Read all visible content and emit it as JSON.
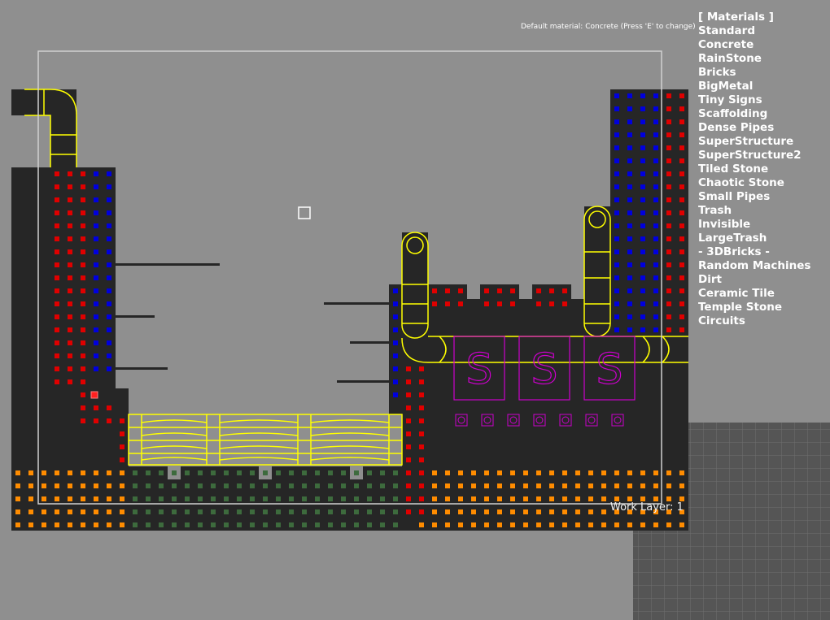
{
  "hint_text": "Default material: Concrete (Press 'E' to change)",
  "work_layer_text": "Work Layer: 1",
  "materials_menu": {
    "header": "[ Materials ]",
    "items": [
      "Standard",
      "Concrete",
      "RainStone",
      "Bricks",
      "BigMetal",
      "Tiny Signs",
      "Scaffolding",
      "Dense Pipes",
      "SuperStructure",
      "SuperStructure2",
      "Tiled Stone",
      "Chaotic Stone",
      "Small Pipes",
      "Trash",
      "Invisible",
      "LargeTrash",
      "- 3DBricks -",
      "Random Machines",
      "Dirt",
      "Ceramic Tile",
      "Temple Stone",
      "Circuits"
    ]
  },
  "machine_signs": [
    "S",
    "S",
    "S"
  ],
  "colors": {
    "background": "#8f8f8f",
    "solid": "#262626",
    "red_dots": "#e00000",
    "blue_dots": "#0000dd",
    "orange_dots": "#ff8c00",
    "green_dots": "#3d6b3d",
    "pipe_outline": "#ffff00",
    "machine_outline": "#cc00cc",
    "border_frame": "#d0d0d0",
    "grid_panel": "#5a5a5a"
  },
  "icons": [
    "cursor-square-icon",
    "pipe-icon",
    "machine-sign-icon",
    "small-machine-icon"
  ]
}
